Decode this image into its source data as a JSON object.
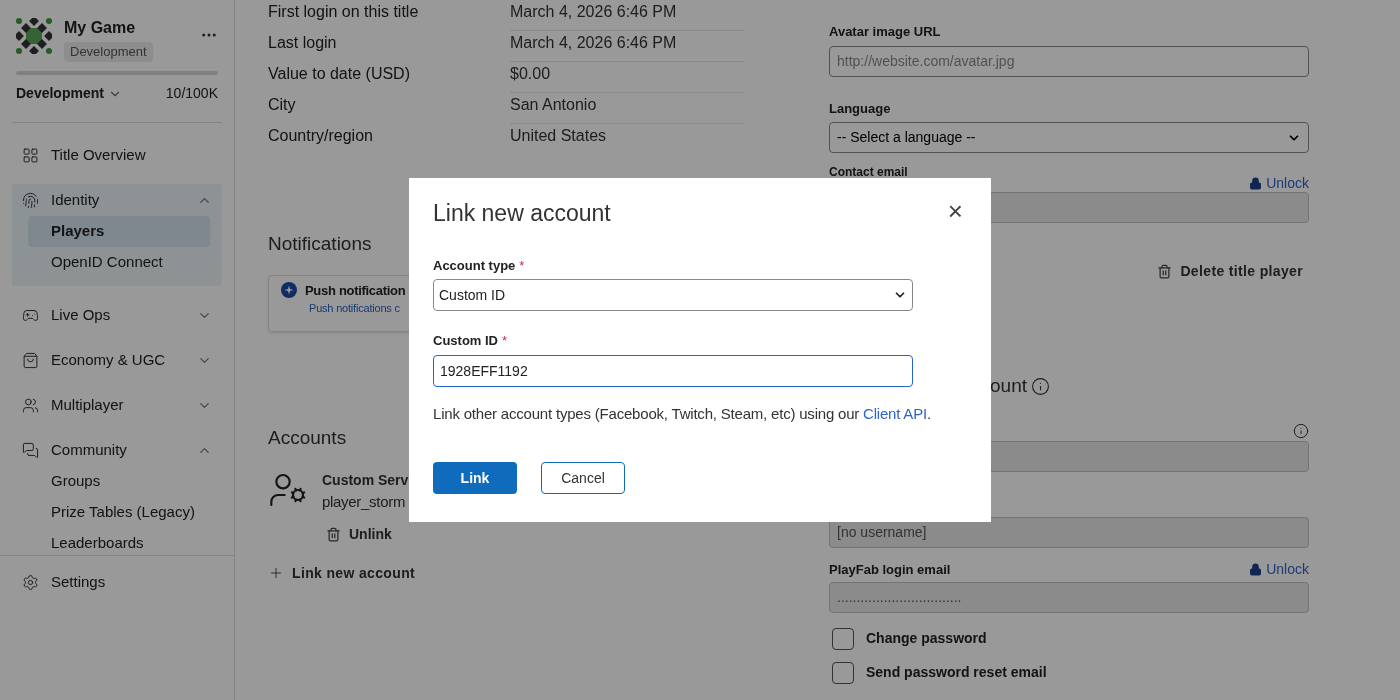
{
  "sidebar": {
    "title": "My Game",
    "badge": "Development",
    "environment": "Development",
    "usage": "10/100K",
    "nav": [
      {
        "label": "Title Overview",
        "kind": "link"
      },
      {
        "label": "Identity",
        "kind": "group",
        "expanded": true,
        "children": [
          {
            "label": "Players",
            "selected": true
          },
          {
            "label": "OpenID Connect",
            "selected": false
          }
        ]
      },
      {
        "label": "Live Ops",
        "kind": "group",
        "expanded": false
      },
      {
        "label": "Economy & UGC",
        "kind": "group",
        "expanded": false
      },
      {
        "label": "Multiplayer",
        "kind": "group",
        "expanded": false
      },
      {
        "label": "Community",
        "kind": "group",
        "expanded": true,
        "children": [
          {
            "label": "Groups",
            "selected": false
          },
          {
            "label": "Prize Tables (Legacy)",
            "selected": false
          },
          {
            "label": "Leaderboards",
            "selected": false
          }
        ]
      }
    ],
    "footer": "Settings"
  },
  "details": [
    {
      "label": "First login on this title",
      "value": "March 4, 2026 6:46 PM"
    },
    {
      "label": "Last login",
      "value": "March 4, 2026 6:46 PM"
    },
    {
      "label": "Value to date (USD)",
      "value": "$0.00"
    },
    {
      "label": "City",
      "value": "San Antonio"
    },
    {
      "label": "Country/region",
      "value": "United States"
    }
  ],
  "notifications": {
    "heading": "Notifications",
    "card_title": "Push notification",
    "card_link": "Push notifications c"
  },
  "accounts": {
    "heading": "Accounts",
    "name": "Custom Serv",
    "id": "player_storm",
    "unlink": "Unlink",
    "add": "Link new account"
  },
  "profile": {
    "avatar_label": "Avatar image URL",
    "avatar_placeholder": "http://website.com/avatar.jpg",
    "language_label": "Language",
    "language_value": "-- Select a language --",
    "contact_label": "Contact email",
    "unlock": "Unlock",
    "delete": "Delete title player",
    "section_heading": "ount",
    "username_value": "[no username]",
    "login_email_label": "PlayFab login email",
    "login_unlock": "Unlock",
    "login_email_value": "................................",
    "checkboxes": [
      {
        "label": "Change password",
        "checked": false
      },
      {
        "label": "Send password reset email",
        "checked": false
      }
    ]
  },
  "dialog": {
    "title": "Link new account",
    "close": "×",
    "type_label": {
      "text": "Account type",
      "required_mark": "*"
    },
    "type_value": "Custom ID",
    "id_label": {
      "text": "Custom ID",
      "required_mark": "*"
    },
    "id_value": "1928EFF1192",
    "note": "Link other account types (Facebook, Twitch, Steam, etc) using our ",
    "note_link": "Client API",
    "note_end": ".",
    "buttons": [
      {
        "label": "Link",
        "kind": "primary"
      },
      {
        "label": "Cancel",
        "kind": "secondary"
      }
    ]
  }
}
